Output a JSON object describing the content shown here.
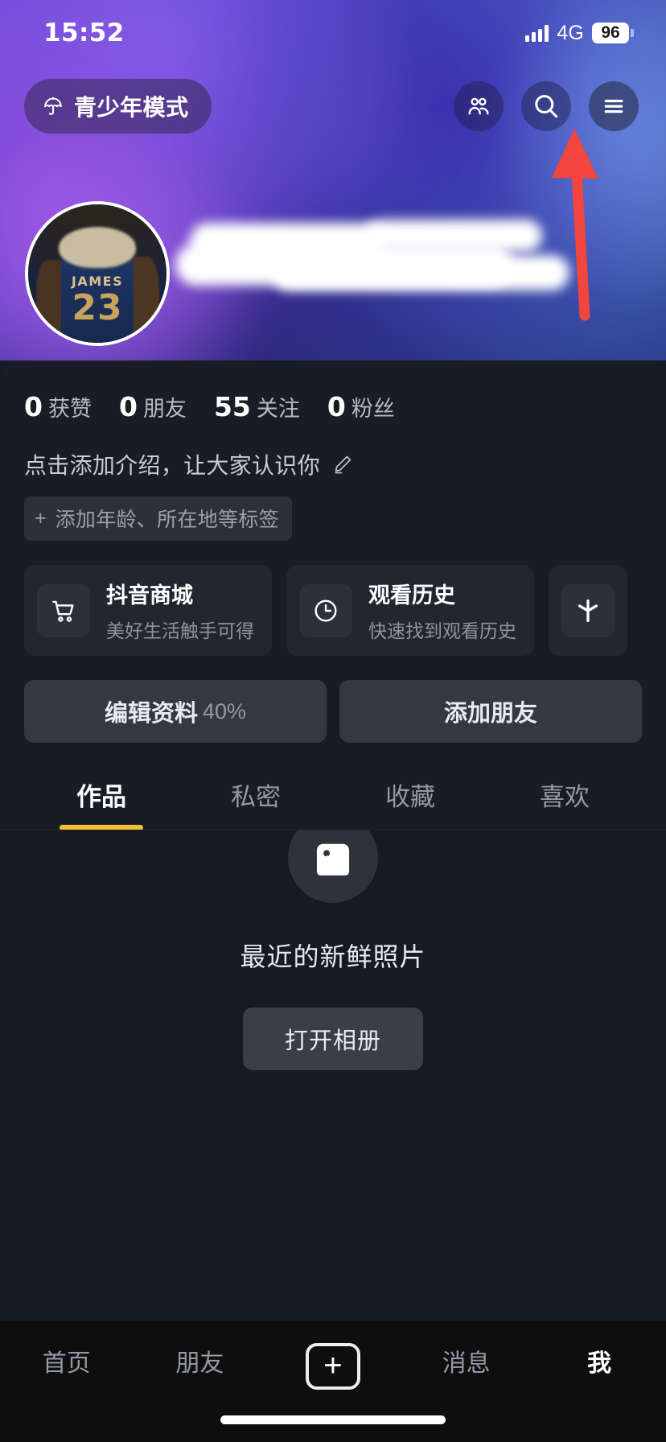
{
  "status_bar": {
    "time": "15:52",
    "network": "4G",
    "battery": "96",
    "signal_icon": "cellular-signal-icon",
    "battery_icon": "battery-icon"
  },
  "header": {
    "teen_mode_label": "青少年模式",
    "teen_mode_icon": "umbrella-icon",
    "icons": [
      {
        "name": "friends-icon",
        "label": "朋友"
      },
      {
        "name": "search-icon",
        "label": "搜索"
      },
      {
        "name": "hamburger-menu-icon",
        "label": "菜单"
      }
    ]
  },
  "profile": {
    "avatar_alt": "JAMES 23",
    "avatar_jersey_name": "JAMES",
    "avatar_jersey_number": "23",
    "stats": [
      {
        "value": "0",
        "label": "获赞"
      },
      {
        "value": "0",
        "label": "朋友"
      },
      {
        "value": "55",
        "label": "关注"
      },
      {
        "value": "0",
        "label": "粉丝"
      }
    ],
    "bio_placeholder": "点击添加介绍，让大家认识你",
    "bio_edit_icon": "pencil-icon",
    "tag_plus": "+",
    "tag_label": "添加年龄、所在地等标签"
  },
  "shortcuts": [
    {
      "title": "抖音商城",
      "subtitle": "美好生活触手可得",
      "icon": "shopping-cart-icon"
    },
    {
      "title": "观看历史",
      "subtitle": "快速找到观看历史",
      "icon": "clock-icon"
    },
    {
      "title": "",
      "subtitle": "",
      "icon": "spark-icon"
    }
  ],
  "actions": [
    {
      "label": "编辑资料",
      "suffix": "40%"
    },
    {
      "label": "添加朋友",
      "suffix": ""
    }
  ],
  "tabs": [
    {
      "label": "作品",
      "active": true
    },
    {
      "label": "私密",
      "active": false
    },
    {
      "label": "收藏",
      "active": false
    },
    {
      "label": "喜欢",
      "active": false
    }
  ],
  "empty_state": {
    "icon": "image-placeholder-icon",
    "title": "最近的新鲜照片",
    "button_label": "打开相册"
  },
  "bottom_nav": [
    {
      "label": "首页",
      "active": false
    },
    {
      "label": "朋友",
      "active": false
    },
    {
      "label": "+",
      "active": false
    },
    {
      "label": "消息",
      "active": false
    },
    {
      "label": "我",
      "active": true
    }
  ],
  "colors": {
    "accent_tab": "#f3c034",
    "annotation_arrow": "#f2453d",
    "page_bg": "#161a22",
    "card_bg": "#181c24",
    "nav_bg": "#0e0e0e"
  },
  "annotation": {
    "arrow_icon": "red-arrow-pointing-up",
    "target": "hamburger-menu-icon"
  }
}
